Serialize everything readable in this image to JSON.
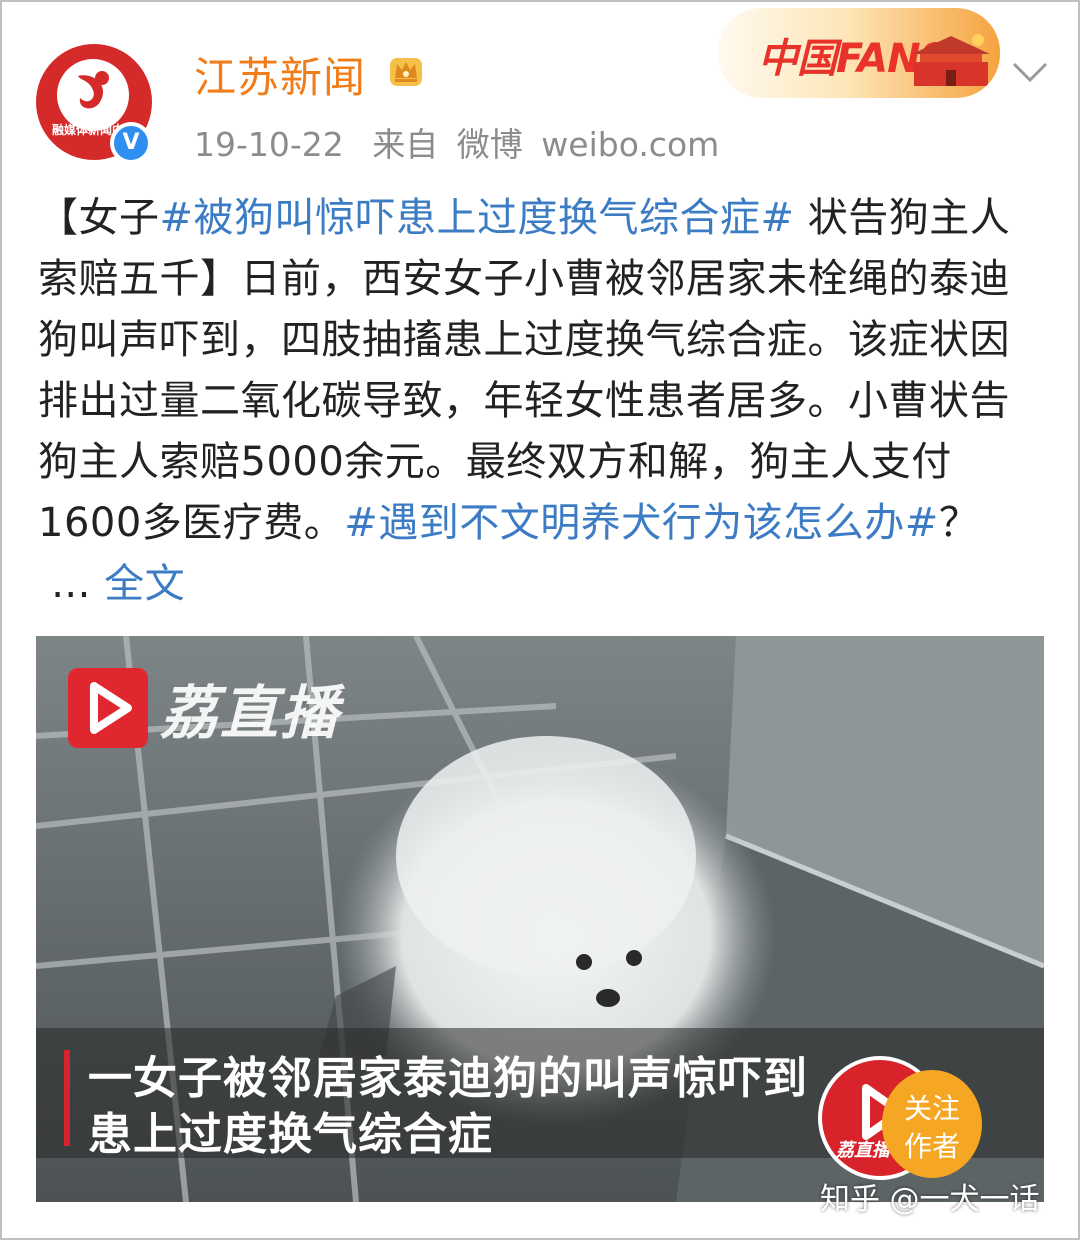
{
  "header": {
    "avatar_text": "融媒体新闻中心",
    "user_name": "江苏新闻",
    "verified_mark": "V",
    "date": "19-10-22",
    "source_prefix": "来自",
    "source_app": "微博",
    "source_domain": "weibo.com",
    "fans_badge": "中国FANS",
    "icons": [
      "crown-icon",
      "verified-icon",
      "chevron-down-icon"
    ],
    "colors": {
      "name": "#f07c1a",
      "tag": "#3c7cc4",
      "verified": "#2f8ff0",
      "brand_red": "#e0262e"
    }
  },
  "post": {
    "open_bracket": "【女子",
    "tag_1": "#被狗叫惊吓患上过度换气综合症#",
    "title_rest": " 状告狗主人索赔五千】",
    "body": "日前，西安女子小曹被邻居家未栓绳的泰迪狗叫声吓到，四肢抽搐患上过度换气综合症。该症状因排出过量二氧化碳导致，年轻女性患者居多。小曹状告狗主人索赔5000余元。最终双方和解，狗主人支付1600多医疗费。",
    "tag_2": "#遇到不文明养犬行为该怎么办#",
    "question": "？",
    "ellipsis": " ... ",
    "more_link": "全文"
  },
  "video": {
    "channel_logo_name": "荔直播",
    "subtitle_line_1": "一女子被邻居家泰迪狗的叫声惊吓到",
    "subtitle_line_2": "患上过度换气综合症",
    "follow_brand": "荔直播",
    "follow_label_1": "关注",
    "follow_label_2": "作者"
  },
  "watermark": "知乎 @一犬一话"
}
